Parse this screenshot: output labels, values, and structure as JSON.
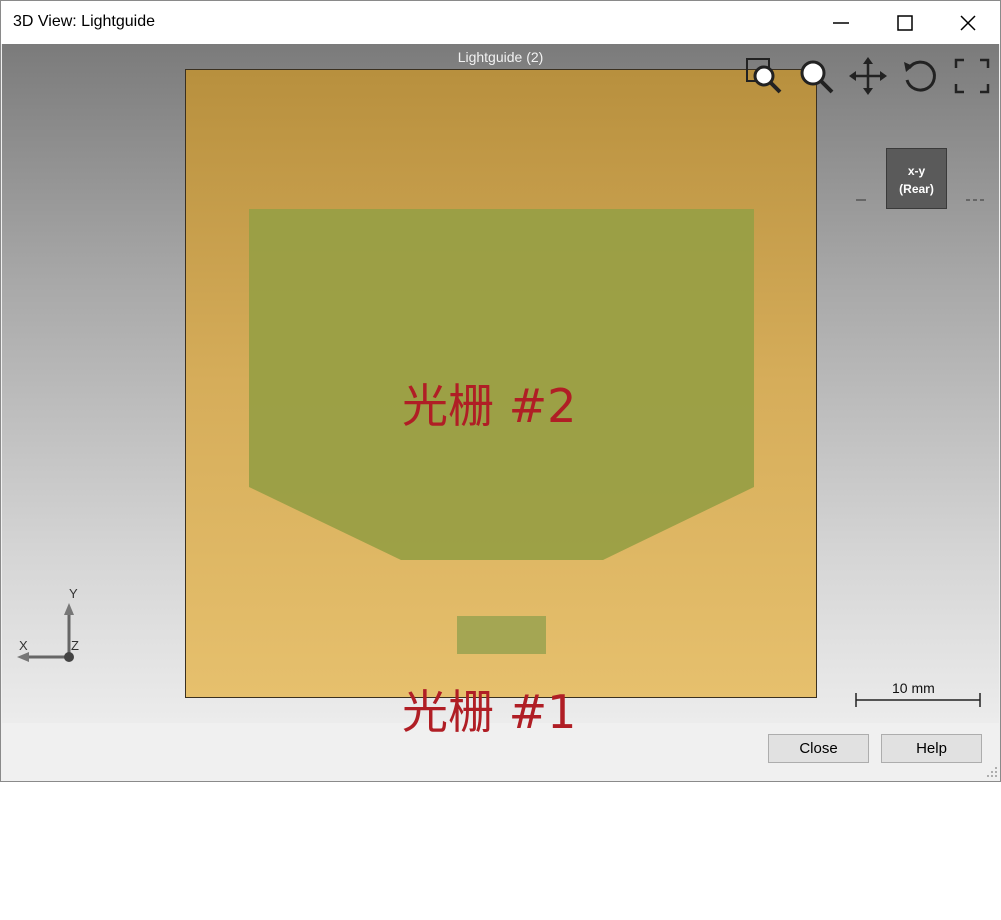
{
  "window": {
    "title": "3D View: Lightguide",
    "controls": [
      "minimize-icon",
      "maximize-icon",
      "close-icon"
    ]
  },
  "viewport": {
    "object_label": "Lightguide (2)",
    "toolbar": [
      "zoom-window-icon",
      "zoom-icon",
      "pan-icon",
      "rotate-icon",
      "fit-view-icon"
    ],
    "viewcube": {
      "line1": "x-y",
      "line2": "(Rear)"
    },
    "axes": {
      "x": "X",
      "y": "Y",
      "z": "Z"
    },
    "scale_bar": "10 mm",
    "annotations": {
      "grating2": "光栅 #2",
      "grating1": "光栅 #1"
    },
    "colors": {
      "lightguide": "#d6ad5a",
      "grating": "#a4a653",
      "annotation": "#b01e25"
    }
  },
  "buttons": {
    "close": "Close",
    "help": "Help"
  }
}
